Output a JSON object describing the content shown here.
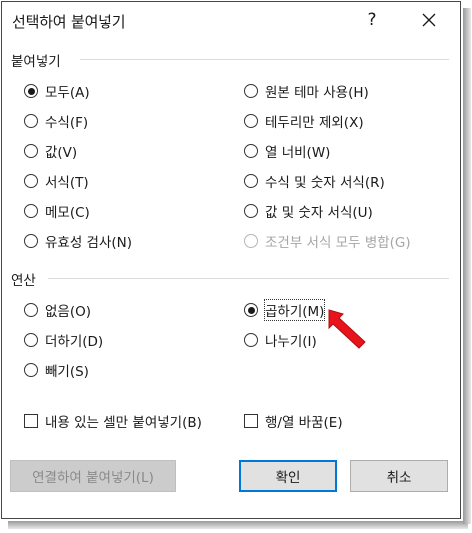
{
  "dialog": {
    "title": "선택하여 붙여넣기",
    "help_label": "?"
  },
  "paste_group": {
    "label": "붙여넣기",
    "left_options": [
      {
        "label": "모두(A)",
        "selected": true
      },
      {
        "label": "수식(F)",
        "selected": false
      },
      {
        "label": "값(V)",
        "selected": false
      },
      {
        "label": "서식(T)",
        "selected": false
      },
      {
        "label": "메모(C)",
        "selected": false
      },
      {
        "label": "유효성 검사(N)",
        "selected": false
      }
    ],
    "right_options": [
      {
        "label": "원본 테마 사용(H)",
        "selected": false
      },
      {
        "label": "테두리만 제외(X)",
        "selected": false
      },
      {
        "label": "열 너비(W)",
        "selected": false
      },
      {
        "label": "수식 및 숫자 서식(R)",
        "selected": false
      },
      {
        "label": "값 및 숫자 서식(U)",
        "selected": false
      },
      {
        "label": "조건부 서식 모두 병합(G)",
        "selected": false,
        "disabled": true
      }
    ]
  },
  "operation_group": {
    "label": "연산",
    "left_options": [
      {
        "label": "없음(O)",
        "selected": false
      },
      {
        "label": "더하기(D)",
        "selected": false
      },
      {
        "label": "빼기(S)",
        "selected": false
      }
    ],
    "right_options": [
      {
        "label": "곱하기(M)",
        "selected": true
      },
      {
        "label": "나누기(I)",
        "selected": false
      }
    ]
  },
  "checkboxes": {
    "skip_blanks": {
      "label": "내용 있는 셀만 붙여넣기(B)",
      "checked": false
    },
    "transpose": {
      "label": "행/열 바꿈(E)",
      "checked": false
    }
  },
  "buttons": {
    "paste_link": "연결하여 붙여넣기(L)",
    "ok": "확인",
    "cancel": "취소"
  },
  "colors": {
    "accent": "#0078d7",
    "annotation_arrow": "#e8141b"
  },
  "icons": [
    "close-icon",
    "red-arrow-annotation"
  ]
}
